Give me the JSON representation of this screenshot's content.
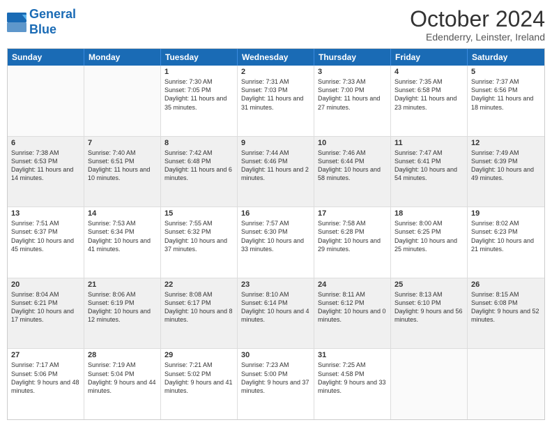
{
  "logo": {
    "line1": "General",
    "line2": "Blue"
  },
  "title": "October 2024",
  "location": "Edenderry, Leinster, Ireland",
  "days": [
    "Sunday",
    "Monday",
    "Tuesday",
    "Wednesday",
    "Thursday",
    "Friday",
    "Saturday"
  ],
  "rows": [
    [
      {
        "day": "",
        "text": ""
      },
      {
        "day": "",
        "text": ""
      },
      {
        "day": "1",
        "text": "Sunrise: 7:30 AM\nSunset: 7:05 PM\nDaylight: 11 hours and 35 minutes."
      },
      {
        "day": "2",
        "text": "Sunrise: 7:31 AM\nSunset: 7:03 PM\nDaylight: 11 hours and 31 minutes."
      },
      {
        "day": "3",
        "text": "Sunrise: 7:33 AM\nSunset: 7:00 PM\nDaylight: 11 hours and 27 minutes."
      },
      {
        "day": "4",
        "text": "Sunrise: 7:35 AM\nSunset: 6:58 PM\nDaylight: 11 hours and 23 minutes."
      },
      {
        "day": "5",
        "text": "Sunrise: 7:37 AM\nSunset: 6:56 PM\nDaylight: 11 hours and 18 minutes."
      }
    ],
    [
      {
        "day": "6",
        "text": "Sunrise: 7:38 AM\nSunset: 6:53 PM\nDaylight: 11 hours and 14 minutes."
      },
      {
        "day": "7",
        "text": "Sunrise: 7:40 AM\nSunset: 6:51 PM\nDaylight: 11 hours and 10 minutes."
      },
      {
        "day": "8",
        "text": "Sunrise: 7:42 AM\nSunset: 6:48 PM\nDaylight: 11 hours and 6 minutes."
      },
      {
        "day": "9",
        "text": "Sunrise: 7:44 AM\nSunset: 6:46 PM\nDaylight: 11 hours and 2 minutes."
      },
      {
        "day": "10",
        "text": "Sunrise: 7:46 AM\nSunset: 6:44 PM\nDaylight: 10 hours and 58 minutes."
      },
      {
        "day": "11",
        "text": "Sunrise: 7:47 AM\nSunset: 6:41 PM\nDaylight: 10 hours and 54 minutes."
      },
      {
        "day": "12",
        "text": "Sunrise: 7:49 AM\nSunset: 6:39 PM\nDaylight: 10 hours and 49 minutes."
      }
    ],
    [
      {
        "day": "13",
        "text": "Sunrise: 7:51 AM\nSunset: 6:37 PM\nDaylight: 10 hours and 45 minutes."
      },
      {
        "day": "14",
        "text": "Sunrise: 7:53 AM\nSunset: 6:34 PM\nDaylight: 10 hours and 41 minutes."
      },
      {
        "day": "15",
        "text": "Sunrise: 7:55 AM\nSunset: 6:32 PM\nDaylight: 10 hours and 37 minutes."
      },
      {
        "day": "16",
        "text": "Sunrise: 7:57 AM\nSunset: 6:30 PM\nDaylight: 10 hours and 33 minutes."
      },
      {
        "day": "17",
        "text": "Sunrise: 7:58 AM\nSunset: 6:28 PM\nDaylight: 10 hours and 29 minutes."
      },
      {
        "day": "18",
        "text": "Sunrise: 8:00 AM\nSunset: 6:25 PM\nDaylight: 10 hours and 25 minutes."
      },
      {
        "day": "19",
        "text": "Sunrise: 8:02 AM\nSunset: 6:23 PM\nDaylight: 10 hours and 21 minutes."
      }
    ],
    [
      {
        "day": "20",
        "text": "Sunrise: 8:04 AM\nSunset: 6:21 PM\nDaylight: 10 hours and 17 minutes."
      },
      {
        "day": "21",
        "text": "Sunrise: 8:06 AM\nSunset: 6:19 PM\nDaylight: 10 hours and 12 minutes."
      },
      {
        "day": "22",
        "text": "Sunrise: 8:08 AM\nSunset: 6:17 PM\nDaylight: 10 hours and 8 minutes."
      },
      {
        "day": "23",
        "text": "Sunrise: 8:10 AM\nSunset: 6:14 PM\nDaylight: 10 hours and 4 minutes."
      },
      {
        "day": "24",
        "text": "Sunrise: 8:11 AM\nSunset: 6:12 PM\nDaylight: 10 hours and 0 minutes."
      },
      {
        "day": "25",
        "text": "Sunrise: 8:13 AM\nSunset: 6:10 PM\nDaylight: 9 hours and 56 minutes."
      },
      {
        "day": "26",
        "text": "Sunrise: 8:15 AM\nSunset: 6:08 PM\nDaylight: 9 hours and 52 minutes."
      }
    ],
    [
      {
        "day": "27",
        "text": "Sunrise: 7:17 AM\nSunset: 5:06 PM\nDaylight: 9 hours and 48 minutes."
      },
      {
        "day": "28",
        "text": "Sunrise: 7:19 AM\nSunset: 5:04 PM\nDaylight: 9 hours and 44 minutes."
      },
      {
        "day": "29",
        "text": "Sunrise: 7:21 AM\nSunset: 5:02 PM\nDaylight: 9 hours and 41 minutes."
      },
      {
        "day": "30",
        "text": "Sunrise: 7:23 AM\nSunset: 5:00 PM\nDaylight: 9 hours and 37 minutes."
      },
      {
        "day": "31",
        "text": "Sunrise: 7:25 AM\nSunset: 4:58 PM\nDaylight: 9 hours and 33 minutes."
      },
      {
        "day": "",
        "text": ""
      },
      {
        "day": "",
        "text": ""
      }
    ]
  ]
}
